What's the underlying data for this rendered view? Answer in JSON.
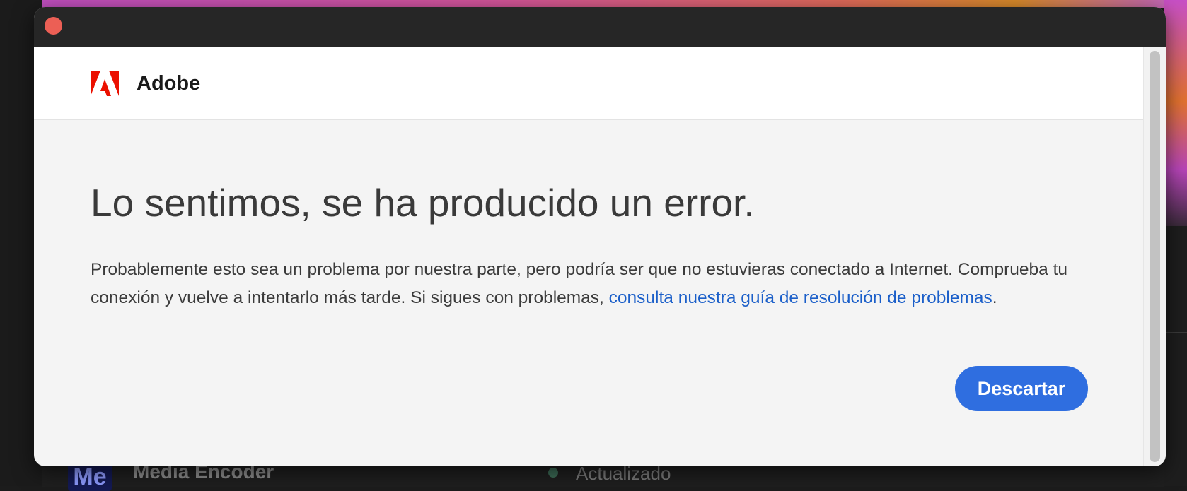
{
  "background": {
    "app_icon_text": "Me",
    "app_name": "Media Encoder",
    "status_text": "Actualizado"
  },
  "dialog": {
    "brand": "Adobe",
    "title": "Lo sentimos, se ha producido un error.",
    "message_part1": "Probablemente esto sea un problema por nuestra parte, pero podría ser que no estuvieras conectado a Internet. Comprueba tu conexión y vuelve a intentarlo más tarde. Si sigues con problemas, ",
    "help_link": "consulta nuestra guía de resolución de problemas",
    "message_end": ".",
    "dismiss_label": "Descartar"
  },
  "colors": {
    "accent_blue": "#2f6ee0",
    "link_blue": "#1b5fc9",
    "adobe_red": "#eb1000",
    "close_red": "#ec5f55"
  }
}
